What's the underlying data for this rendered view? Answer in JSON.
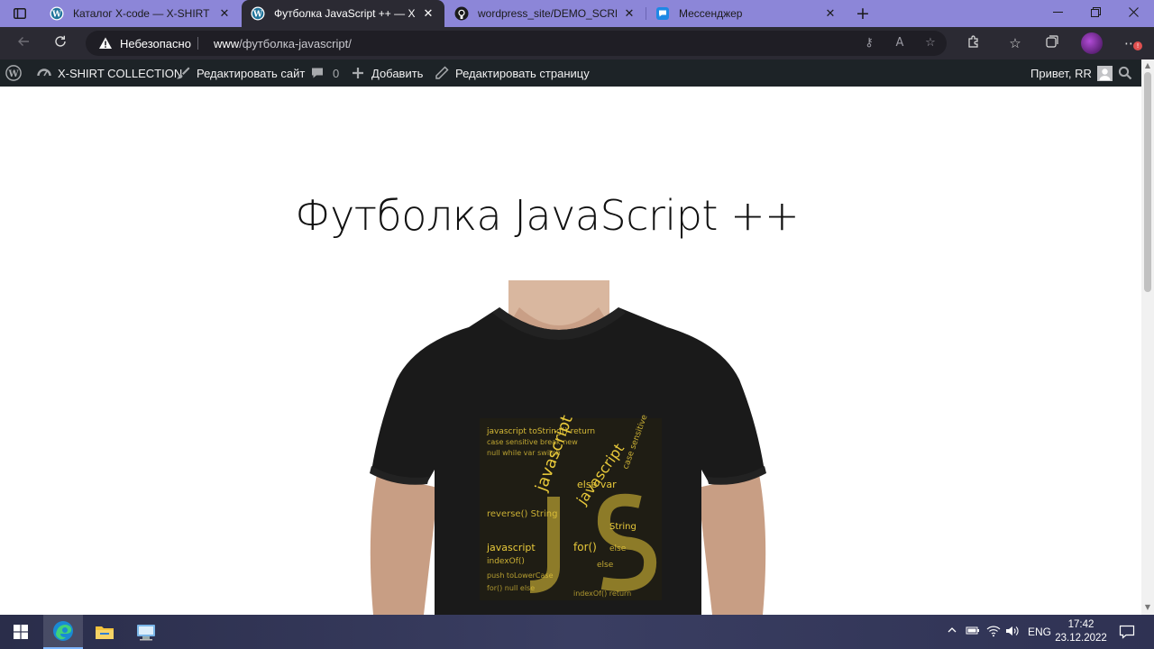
{
  "browser": {
    "tabs": [
      {
        "title": "Каталог X-code — X-SHIRT COLL",
        "icon": "wordpress-icon",
        "active": false
      },
      {
        "title": "Футболка JavaScript ++ — X-SH",
        "icon": "wordpress-icon",
        "active": true
      },
      {
        "title": "wordpress_site/DEMO_SCREENS",
        "icon": "github-icon",
        "active": false
      },
      {
        "title": "Мессенджер",
        "icon": "messenger-icon",
        "active": false
      }
    ],
    "address": {
      "security_label": "Небезопасно",
      "url_host": "www",
      "url_path": "/футболка-javascript/"
    }
  },
  "adminbar": {
    "site_name": "X-SHIRT COLLECTION",
    "customize": "Редактировать сайт",
    "comments_count": "0",
    "new_content": "Добавить",
    "edit_page": "Редактировать страницу",
    "greeting": "Привет, RR"
  },
  "page": {
    "title": "Футболка JavaScript ++",
    "product_image_alt": "JavaScript word-cloud t-shirt"
  },
  "taskbar": {
    "language": "ENG",
    "time": "17:42",
    "date": "23.12.2022"
  },
  "colors": {
    "tabstrip": "#8c86d8",
    "toolbar": "#2b2a33",
    "adminbar": "#1d2327",
    "shirt": "#1a1a1a",
    "print_yellow": "#e8c93a"
  }
}
